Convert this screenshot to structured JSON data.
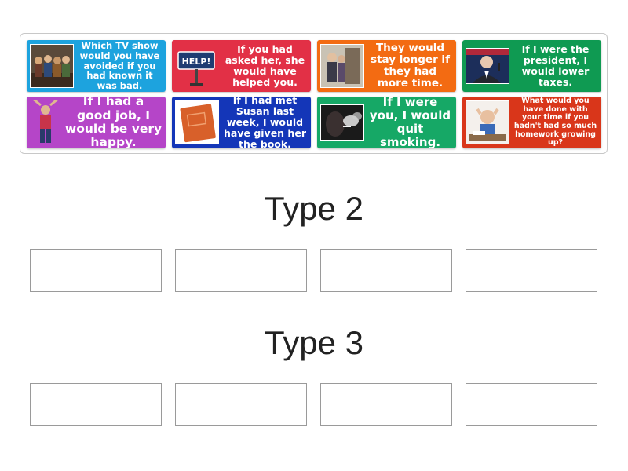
{
  "cards": [
    {
      "text": "Which TV show would you have avoided if you had known it was bad.",
      "color": "#1da3de",
      "icon": "tv-show-cast-icon"
    },
    {
      "text": "If you had asked her, she would have helped you.",
      "color": "#e23046",
      "icon": "help-sign-icon",
      "sign_text": "HELP!"
    },
    {
      "text": "They would stay longer if they had more time.",
      "color": "#f36b12",
      "icon": "people-at-door-icon"
    },
    {
      "text": "If I were the president, I would lower taxes.",
      "color": "#0f9a52",
      "icon": "president-speaking-icon"
    },
    {
      "text": "If I had a good job, I would be very happy.",
      "color": "#b545c8",
      "icon": "happy-person-icon"
    },
    {
      "text": "If I had met Susan last week, I would have given her the book.",
      "color": "#1436b8",
      "icon": "book-icon"
    },
    {
      "text": "If I were you, I would quit smoking.",
      "color": "#16a866",
      "icon": "smoking-icon"
    },
    {
      "text": "What would you have done with your time if you hadn't had so much homework growing up?",
      "color": "#d9361a",
      "icon": "stressed-student-icon"
    }
  ],
  "groups": [
    {
      "title": "Type 2",
      "slots": 4
    },
    {
      "title": "Type 3",
      "slots": 4
    }
  ]
}
